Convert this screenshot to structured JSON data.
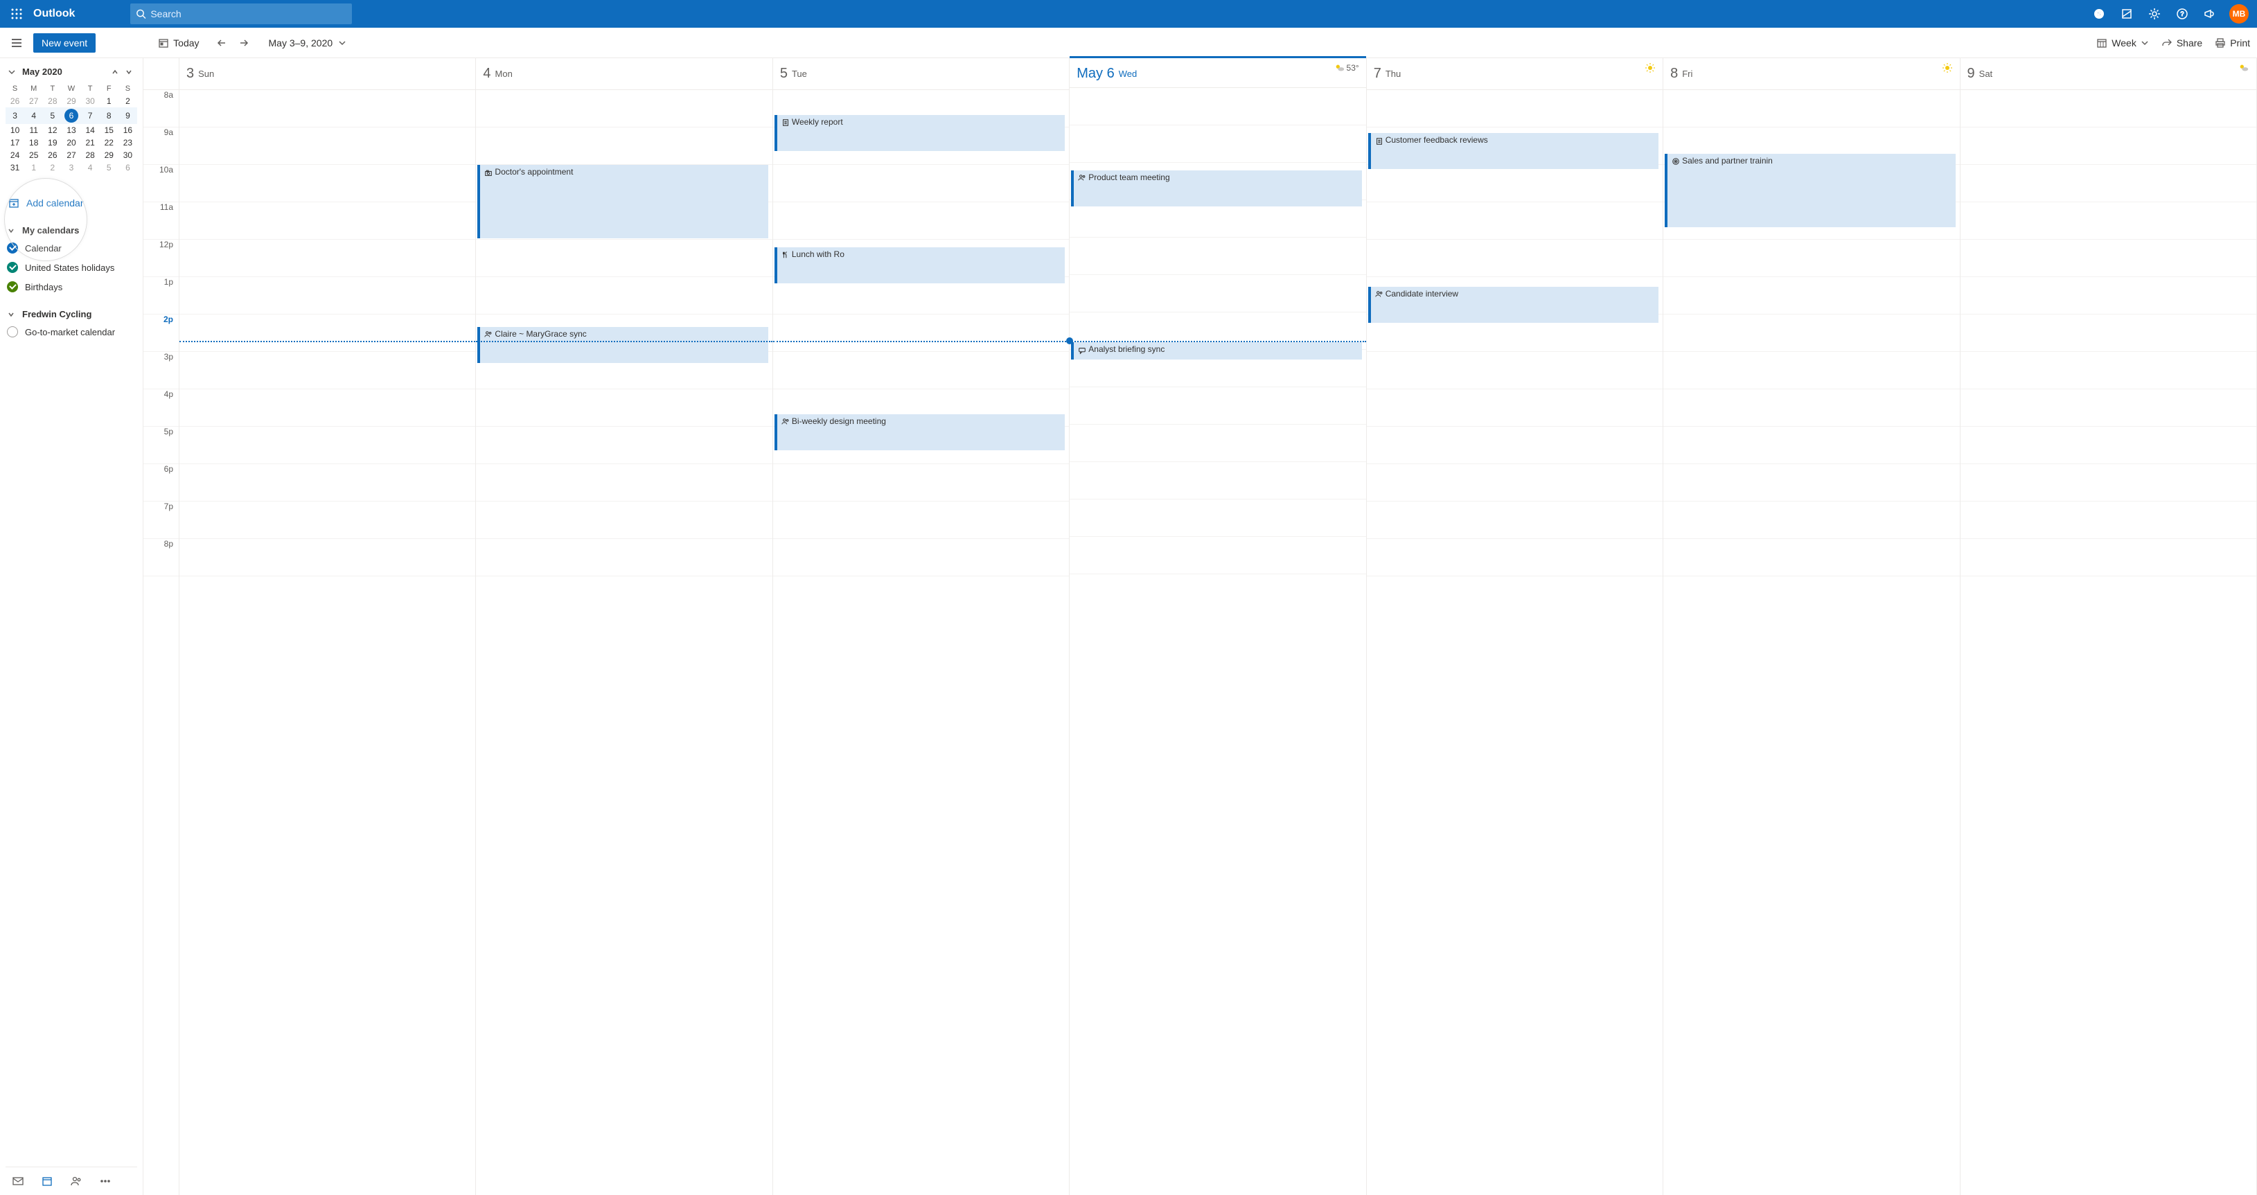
{
  "header": {
    "brand": "Outlook",
    "search_placeholder": "Search",
    "avatar_initials": "MB"
  },
  "cmdbar": {
    "new_event": "New event",
    "today": "Today",
    "date_range": "May 3–9, 2020",
    "view_label": "Week",
    "share": "Share",
    "print": "Print"
  },
  "mini_cal": {
    "title": "May 2020",
    "dow": [
      "S",
      "M",
      "T",
      "W",
      "T",
      "F",
      "S"
    ],
    "weeks": [
      {
        "days": [
          "26",
          "27",
          "28",
          "29",
          "30",
          "1",
          "2"
        ],
        "dim_until": 5,
        "current": false
      },
      {
        "days": [
          "3",
          "4",
          "5",
          "6",
          "7",
          "8",
          "9"
        ],
        "today_index": 3,
        "current": true
      },
      {
        "days": [
          "10",
          "11",
          "12",
          "13",
          "14",
          "15",
          "16"
        ],
        "current": false
      },
      {
        "days": [
          "17",
          "18",
          "19",
          "20",
          "21",
          "22",
          "23"
        ],
        "current": false
      },
      {
        "days": [
          "24",
          "25",
          "26",
          "27",
          "28",
          "29",
          "30"
        ],
        "current": false
      },
      {
        "days": [
          "31",
          "1",
          "2",
          "3",
          "4",
          "5",
          "6"
        ],
        "dim_from": 1,
        "current": false
      }
    ]
  },
  "sidebar": {
    "add_calendar": "Add calendar",
    "groups": [
      {
        "name": "My calendars",
        "expanded": true,
        "items": [
          {
            "label": "Calendar",
            "color": "#0F6CBD",
            "checked": true
          },
          {
            "label": "United States holidays",
            "color": "#008575",
            "checked": true
          },
          {
            "label": "Birthdays",
            "color": "#498205",
            "checked": true
          }
        ]
      },
      {
        "name": "Fredwin Cycling",
        "expanded": true,
        "items": [
          {
            "label": "Go-to-market calendar",
            "color": "",
            "checked": false
          }
        ]
      }
    ]
  },
  "timescale": [
    "8a",
    "9a",
    "10a",
    "11a",
    "12p",
    "1p",
    "2p",
    "3p",
    "4p",
    "5p",
    "6p",
    "7p",
    "8p"
  ],
  "current_hour_index": 6,
  "now_offset_ratio": 0.7,
  "days": [
    {
      "num": "3",
      "dow": "Sun",
      "today": false,
      "weather": null,
      "events": []
    },
    {
      "num": "4",
      "dow": "Mon",
      "today": false,
      "weather": null,
      "events": [
        {
          "title": "Doctor's appointment",
          "icon": "camera",
          "start": 2,
          "dur": 2
        },
        {
          "title": "Claire ~ MaryGrace sync",
          "icon": "people",
          "start": 6.33,
          "dur": 1
        }
      ]
    },
    {
      "num": "5",
      "dow": "Tue",
      "today": false,
      "weather": null,
      "events": [
        {
          "title": "Weekly report",
          "icon": "doc",
          "start": 0.66,
          "dur": 1
        },
        {
          "title": "Lunch with Ro",
          "icon": "food",
          "start": 4.2,
          "dur": 1
        },
        {
          "title": "Bi-weekly design meeting",
          "icon": "people",
          "start": 8.66,
          "dur": 1
        }
      ]
    },
    {
      "num": "May 6",
      "dow": "Wed",
      "today": true,
      "weather": {
        "temp": "53°",
        "icon": "partly"
      },
      "events": [
        {
          "title": "Product team meeting",
          "icon": "people",
          "start": 2.2,
          "dur": 1
        },
        {
          "title": "Analyst briefing sync",
          "icon": "chat",
          "start": 6.8,
          "dur": 0.5
        }
      ]
    },
    {
      "num": "7",
      "dow": "Thu",
      "today": false,
      "weather": {
        "icon": "sun"
      },
      "events": [
        {
          "title": "Customer feedback reviews",
          "icon": "doc",
          "start": 1.15,
          "dur": 1
        },
        {
          "title": "Candidate interview",
          "icon": "people",
          "start": 5.25,
          "dur": 1
        }
      ]
    },
    {
      "num": "8",
      "dow": "Fri",
      "today": false,
      "weather": {
        "icon": "sun"
      },
      "events": [
        {
          "title": "Sales and partner trainin",
          "icon": "target",
          "start": 1.7,
          "dur": 2
        }
      ]
    },
    {
      "num": "9",
      "dow": "Sat",
      "today": false,
      "weather": {
        "icon": "partly"
      },
      "events": []
    }
  ]
}
